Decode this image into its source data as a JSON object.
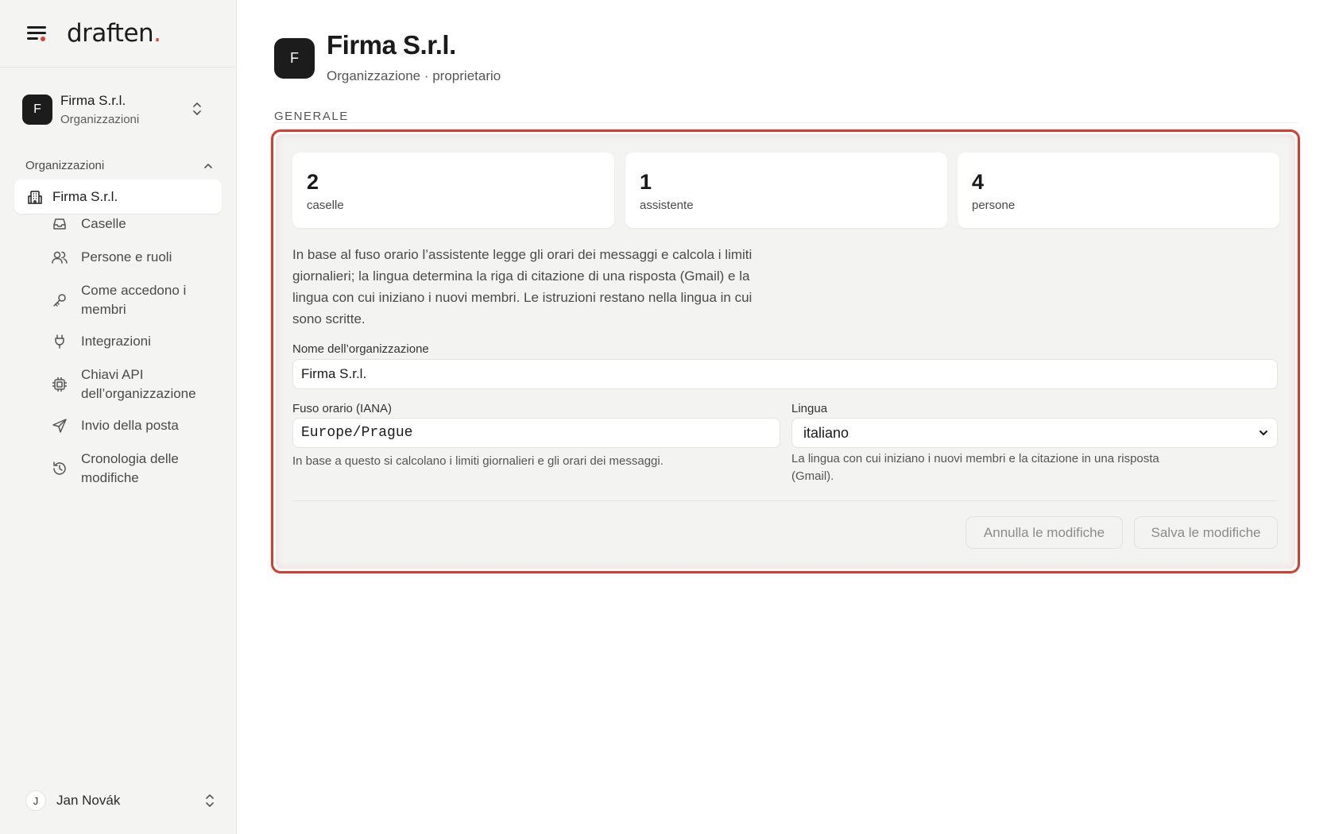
{
  "brand": {
    "name": "draften",
    "dot": "."
  },
  "org_switcher": {
    "initial": "F",
    "name": "Firma S.r.l.",
    "subtitle": "Organizzazioni"
  },
  "sidebar": {
    "section_label": "Organizzazioni",
    "active_item": {
      "label": "Firma S.r.l.",
      "icon": "building-icon"
    },
    "items": [
      {
        "label": "Caselle",
        "icon": "inbox-icon"
      },
      {
        "label": "Persone e ruoli",
        "icon": "users-icon"
      },
      {
        "label": "Come accedono i membri",
        "icon": "key-icon"
      },
      {
        "label": "Integrazioni",
        "icon": "plug-icon"
      },
      {
        "label": "Chiavi API dell’organizzazione",
        "icon": "chip-icon"
      },
      {
        "label": "Invio della posta",
        "icon": "send-icon"
      },
      {
        "label": "Cronologia delle modifiche",
        "icon": "history-icon"
      }
    ]
  },
  "user": {
    "initial": "J",
    "name": "Jan Novák"
  },
  "header": {
    "initial": "F",
    "title": "Firma S.r.l.",
    "subtitle": "Organizzazione · proprietario"
  },
  "section": {
    "label": "GENERALE"
  },
  "stats": [
    {
      "value": "2",
      "label": "caselle"
    },
    {
      "value": "1",
      "label": "assistente"
    },
    {
      "value": "4",
      "label": "persone"
    }
  ],
  "description": "In base al fuso orario l’assistente legge gli orari dei messaggi e calcola i limiti giornalieri; la lingua determina la riga di citazione di una risposta (Gmail) e la lingua con cui iniziano i nuovi membri. Le istruzioni restano nella lingua in cui sono scritte.",
  "form": {
    "org_name": {
      "label": "Nome dell’organizzazione",
      "value": "Firma S.r.l."
    },
    "timezone": {
      "label": "Fuso orario (IANA)",
      "value": "Europe/Prague",
      "help": "In base a questo si calcolano i limiti giornalieri e gli orari dei messaggi."
    },
    "language": {
      "label": "Lingua",
      "value": "italiano",
      "help": "La lingua con cui iniziano i nuovi membri e la citazione in una risposta (Gmail)."
    }
  },
  "actions": {
    "cancel": "Annulla le modifiche",
    "save": "Salva le modifiche"
  },
  "colors": {
    "accent": "#e0402f",
    "highlight_border": "#dd3b29",
    "dark": "#1c1c1c"
  }
}
